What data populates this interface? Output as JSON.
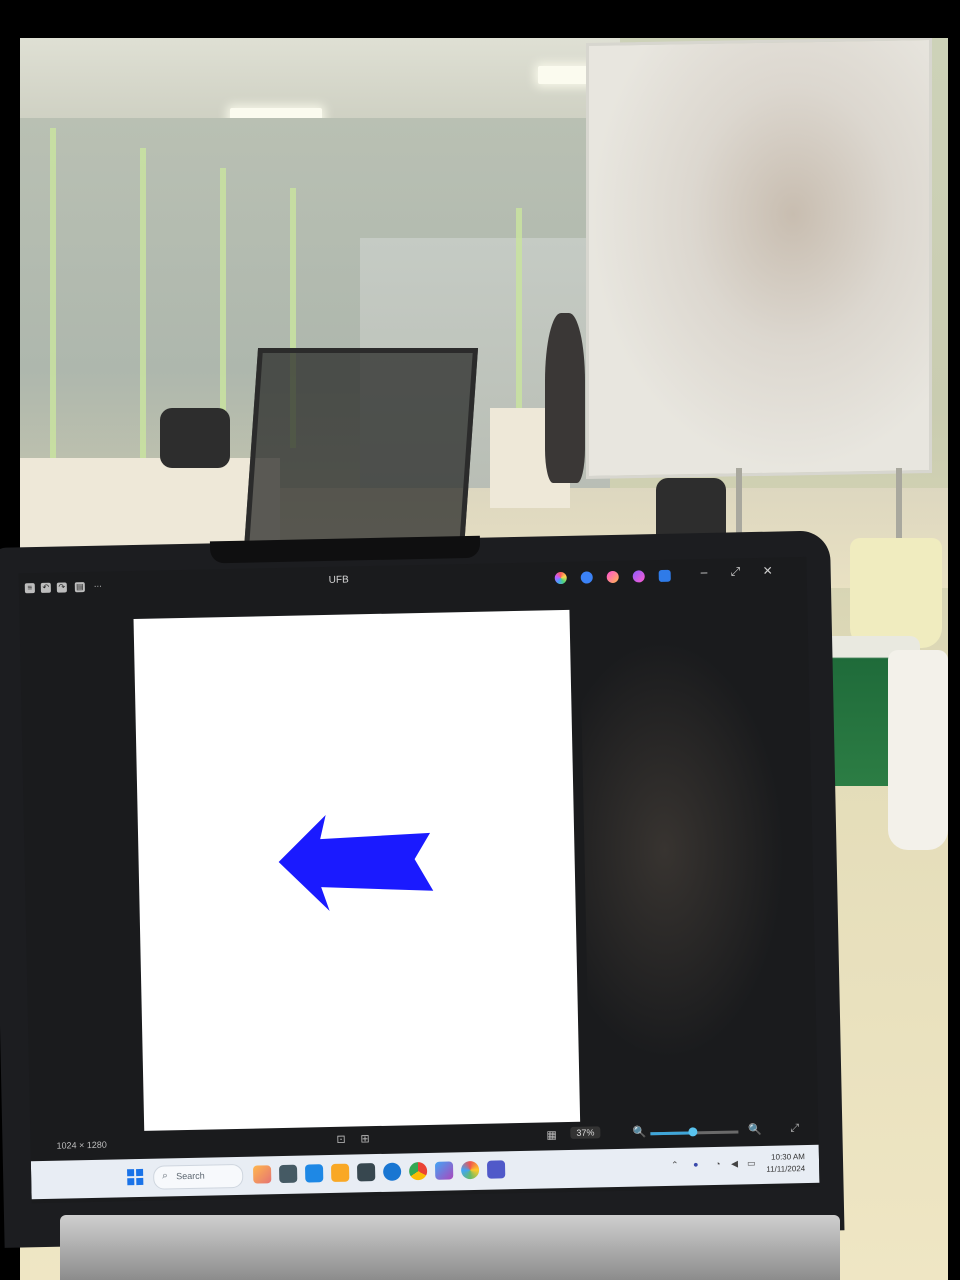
{
  "window": {
    "title": "UFB"
  },
  "toolbar": {
    "left_icons": [
      "menu-icon",
      "undo-icon",
      "redo-icon",
      "layers-icon",
      "more-icon"
    ],
    "right_tools": [
      "color-picker-icon",
      "shapes-icon",
      "effects-icon",
      "ai-icon",
      "share-icon"
    ],
    "window_controls": {
      "minimize": "–",
      "maximize": "⤢",
      "close": "✕"
    }
  },
  "canvas": {
    "arrow_direction": "left",
    "arrow_color": "#1a1aff",
    "background": "#ffffff"
  },
  "statusbar": {
    "dimensions": "1024 × 1280",
    "zoom": "37%",
    "zoom_level": 0.45
  },
  "taskbar": {
    "search_placeholder": "Search",
    "apps": [
      "explorer-icon",
      "edge-icon",
      "folder-icon",
      "store-icon",
      "mail-icon",
      "vscode-icon",
      "chrome-icon",
      "photos-icon",
      "paint-icon",
      "teams-icon"
    ],
    "clock_time": "10:30 AM",
    "clock_date": "11/11/2024"
  },
  "colors": {
    "accent": "#1a73e8",
    "arrow": "#1a1aff"
  }
}
